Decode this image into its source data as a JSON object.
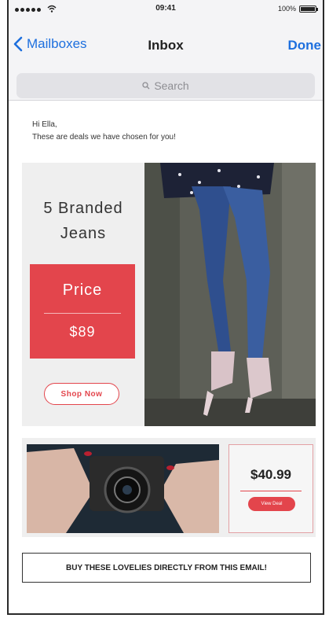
{
  "status_bar": {
    "time": "09:41",
    "battery": "100%"
  },
  "nav": {
    "back_label": "Mailboxes",
    "title": "Inbox",
    "done_label": "Done"
  },
  "search": {
    "placeholder": "Search"
  },
  "greeting": {
    "line1": "Hi Ella,",
    "line2": "These are deals we have chosen for you!"
  },
  "promo1": {
    "title_line1": "5 Branded",
    "title_line2": "Jeans",
    "price_label": "Price",
    "price_value": "$89",
    "cta": "Shop Now"
  },
  "promo2": {
    "price": "$40.99",
    "cta": "View Deal"
  },
  "banner": {
    "text": "BUY THESE LOVELIES DIRECTLY FROM THIS EMAIL!"
  },
  "colors": {
    "accent_red": "#e3454c",
    "ios_blue": "#1d6fde"
  },
  "icons": [
    "wifi-icon",
    "battery-icon",
    "chevron-left-icon",
    "search-icon"
  ]
}
